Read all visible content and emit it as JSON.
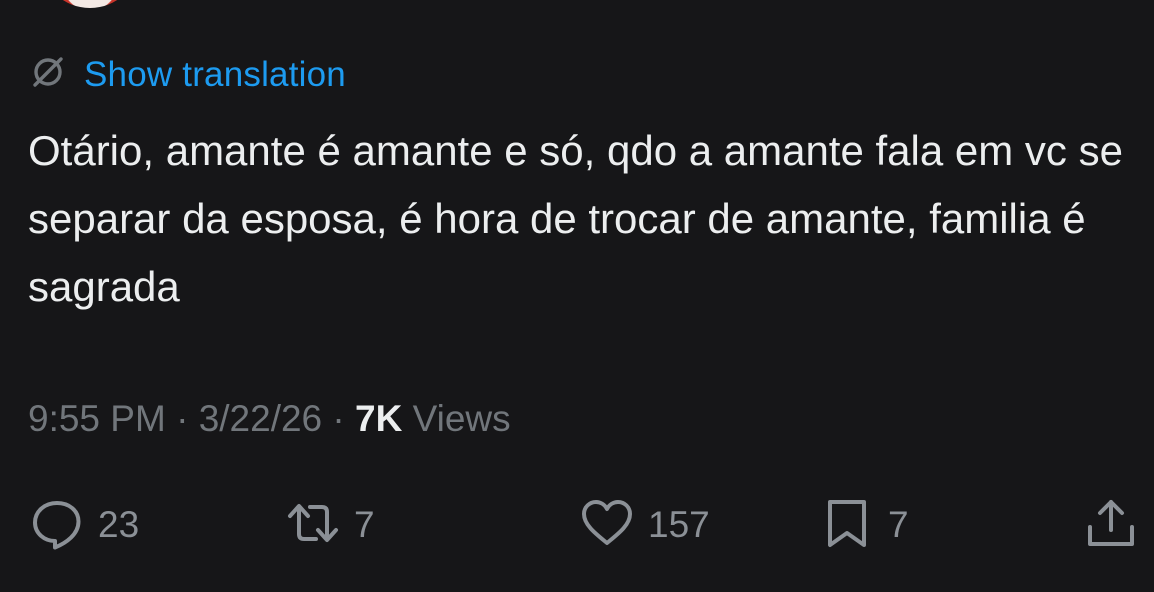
{
  "translation": {
    "label": "Show translation"
  },
  "tweet": {
    "text": "Otário, amante é amante e só, qdo a amante fala em vc se separar da esposa, é hora de trocar de amante, familia é sagrada"
  },
  "meta": {
    "time": "9:55 PM",
    "separator": " · ",
    "date": "3/22/26",
    "views_count": "7K",
    "views_label": " Views"
  },
  "actions": {
    "reply": {
      "icon": "reply-icon",
      "count": "23"
    },
    "repost": {
      "icon": "repost-icon",
      "count": "7"
    },
    "like": {
      "icon": "heart-icon",
      "count": "157"
    },
    "bookmark": {
      "icon": "bookmark-icon",
      "count": "7"
    },
    "share": {
      "icon": "share-icon"
    }
  },
  "colors": {
    "background": "#161618",
    "link": "#1d9bf0",
    "text": "#e7e9ea",
    "muted": "#71767b"
  }
}
